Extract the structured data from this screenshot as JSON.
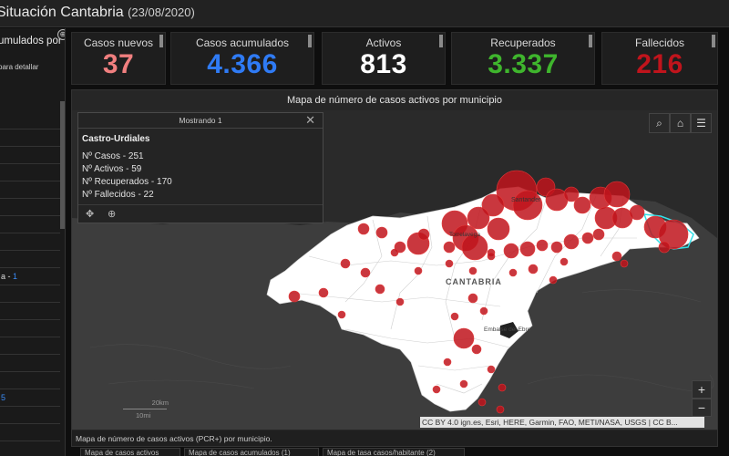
{
  "header": {
    "title": "Situación Cantabria",
    "date": "(23/08/2020)"
  },
  "left_panel": {
    "title": "umulados por",
    "subtitle": "para detallar",
    "info_icon": "info-icon",
    "rows": [
      {
        "label": "",
        "num": ""
      },
      {
        "label": "",
        "num": ""
      },
      {
        "label": "",
        "num": ""
      },
      {
        "label": "",
        "num": ""
      },
      {
        "label": "",
        "num": ""
      },
      {
        "label": "",
        "num": ""
      },
      {
        "label": "",
        "num": ""
      },
      {
        "label": "",
        "num": ""
      },
      {
        "label": "",
        "num": ""
      },
      {
        "label": "a - ",
        "num": "1"
      },
      {
        "label": "",
        "num": ""
      },
      {
        "label": "",
        "num": ""
      },
      {
        "label": "",
        "num": ""
      },
      {
        "label": "",
        "num": ""
      },
      {
        "label": "",
        "num": ""
      },
      {
        "label": "",
        "num": ""
      },
      {
        "label": "",
        "num": "5"
      },
      {
        "label": "",
        "num": ""
      },
      {
        "label": "",
        "num": ""
      },
      {
        "label": "",
        "num": ""
      }
    ]
  },
  "kpis": [
    {
      "label": "Casos nuevos",
      "value": "37",
      "color": "#f07f7f"
    },
    {
      "label": "Casos acumulados",
      "value": "4.366",
      "color": "#2f7bf5"
    },
    {
      "label": "Activos",
      "value": "813",
      "color": "#ffffff"
    },
    {
      "label": "Recuperados",
      "value": "3.337",
      "color": "#3fb52d"
    },
    {
      "label": "Fallecidos",
      "value": "216",
      "color": "#c0141c"
    }
  ],
  "map": {
    "title": "Mapa de número de casos activos por municipio",
    "footer": "Mapa de número de casos activos (PCR+) por municipio.",
    "attribution": "CC BY 4.0 ign.es, Esri, HERE, Garmin, FAO, METI/NASA, USGS | CC B...",
    "scale_km": "20km",
    "scale_mi": "10mi",
    "labels": {
      "santander": "Santander",
      "torrelavega": "Torrelavega",
      "region": "CANTABRIA",
      "embalse": "Embalse del Ebro"
    },
    "tools": [
      "search-icon",
      "home-icon",
      "list-icon"
    ],
    "zoom_in": "+",
    "zoom_out": "−",
    "accent": "#c0141c"
  },
  "popup": {
    "header": "Mostrando 1",
    "close": "✕",
    "title": "Castro-Urdiales",
    "lines": [
      "Nº Casos - 251",
      "Nº Activos - 59",
      "Nº Recuperados - 170",
      "Nº Fallecidos - 22"
    ]
  },
  "tabs": [
    {
      "label": "Mapa de casos activos"
    },
    {
      "label": "Mapa de casos acumulados (1)"
    },
    {
      "label": "Mapa de tasa casos/habitante (2)"
    }
  ]
}
